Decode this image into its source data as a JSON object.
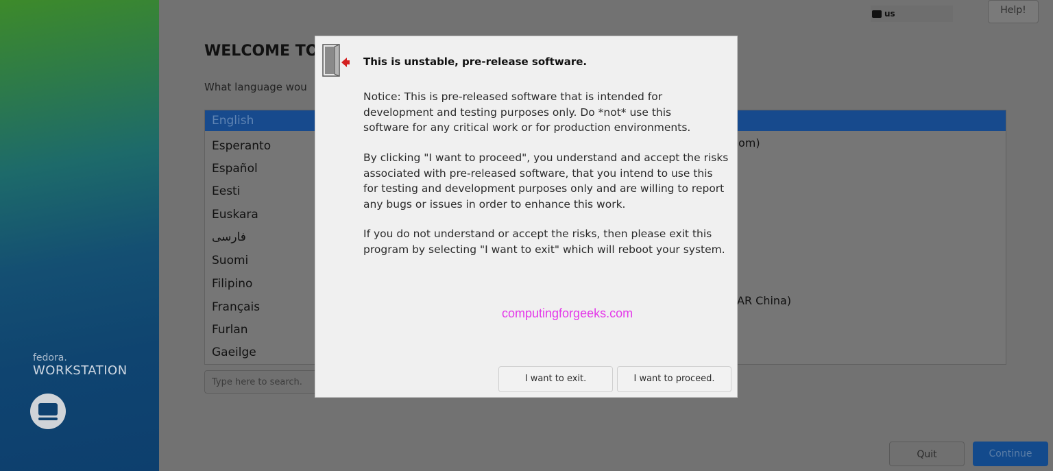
{
  "sidebar": {
    "brand_line1": "fedora.",
    "brand_line2": "WORKSTATION"
  },
  "header": {
    "keyboard_layout": "us",
    "help_label": "Help!"
  },
  "main": {
    "welcome": "WELCOME TO",
    "question": "What language wou",
    "languages": [
      "English",
      "Esperanto",
      "Español",
      "Eesti",
      "Euskara",
      "فارسی",
      "Suomi",
      "Filipino",
      "Français",
      "Furlan",
      "Gaeilge"
    ],
    "selected_language": "English",
    "right_fragments": [
      "om)",
      "AR China)"
    ],
    "search_placeholder": "Type here to search."
  },
  "footer": {
    "quit_label": "Quit",
    "continue_label": "Continue"
  },
  "dialog": {
    "title": "This is unstable, pre-release software.",
    "p1": [
      "Notice: This is pre-released software that is intended for",
      "development and testing purposes only.  Do *not* use this",
      "software for any critical work or for production environments."
    ],
    "p2": [
      "By clicking \"I want to proceed\", you understand and accept the risks",
      "associated with pre-released software, that you intend to use this",
      "for testing and development purposes only and are willing to report",
      "any bugs or issues in order to enhance this work."
    ],
    "p3": [
      "If you do not understand or accept the risks, then please exit this",
      "program by selecting \"I want to exit\" which will reboot your system."
    ],
    "watermark": "computingforgeeks.com",
    "exit_label": "I want to exit.",
    "proceed_label": "I want to proceed."
  },
  "colors": {
    "accent": "#174a8d",
    "watermark": "#e43ae9",
    "warning_arrow": "#d42020"
  }
}
